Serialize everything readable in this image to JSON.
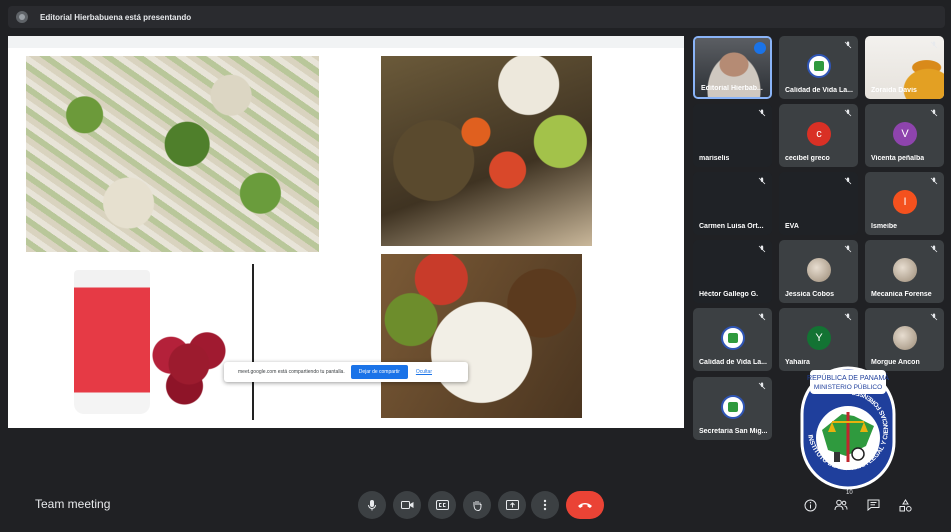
{
  "topbar": {
    "presenting_text": "Editorial Hierbabuena está presentando"
  },
  "share_notice": {
    "message": "meet.google.com está compartiendo tu pantalla.",
    "stop_label": "Dejar de compartir",
    "hide_label": "Ocultar"
  },
  "participants": [
    {
      "name": "Editorial Hierbab...",
      "type": "video"
    },
    {
      "name": "Calidad de Vida La...",
      "type": "logo"
    },
    {
      "name": "Zoraida Davis",
      "type": "video2"
    },
    {
      "name": "mariselis",
      "type": "blank"
    },
    {
      "name": "cecibel greco",
      "type": "letter",
      "letter": "c",
      "color": "#d93025"
    },
    {
      "name": "Vicenta peñalba",
      "type": "letter",
      "letter": "V",
      "color": "#8e44ad"
    },
    {
      "name": "Carmen Luisa Ort...",
      "type": "blank"
    },
    {
      "name": "EVA",
      "type": "blank"
    },
    {
      "name": "Ismeibe",
      "type": "letter",
      "letter": "I",
      "color": "#f4511e"
    },
    {
      "name": "Héctor Gallego G.",
      "type": "blank"
    },
    {
      "name": "Jessica Cobos",
      "type": "photo"
    },
    {
      "name": "Mecanica Forense",
      "type": "photo"
    },
    {
      "name": "Calidad de Vida La...",
      "type": "logo"
    },
    {
      "name": "Yahaira",
      "type": "letter",
      "letter": "Y",
      "color": "#137333"
    },
    {
      "name": "Morgue Ancon",
      "type": "photo"
    },
    {
      "name": "Secretaria San Mig...",
      "type": "logo"
    }
  ],
  "meeting": {
    "name": "Team meeting"
  },
  "controls": {
    "participant_count": "10"
  },
  "institute_logo": {
    "line1": "REPÚBLICA DE PANAMÁ",
    "line2": "MINISTERIO PÚBLICO",
    "ring_text": "INSTITUTO DE MEDICINA LEGAL Y CIENCIAS FORENSES"
  }
}
